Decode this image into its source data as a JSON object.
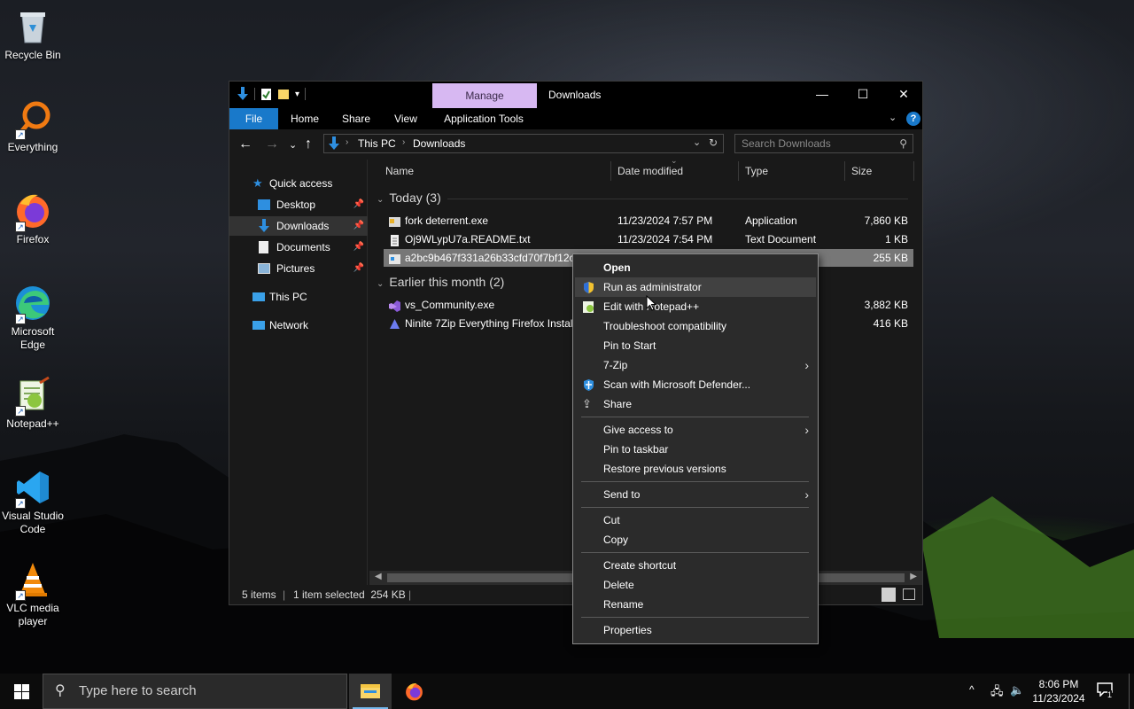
{
  "desktop": {
    "icons": [
      {
        "label": "Recycle Bin",
        "icon": "recycle-bin-icon"
      },
      {
        "label": "Everything",
        "icon": "everything-search-icon"
      },
      {
        "label": "Firefox",
        "icon": "firefox-icon"
      },
      {
        "label": "Microsoft Edge",
        "icon": "edge-icon"
      },
      {
        "label": "Notepad++",
        "icon": "notepadpp-icon"
      },
      {
        "label": "Visual Studio Code",
        "icon": "vscode-icon"
      },
      {
        "label": "VLC media player",
        "icon": "vlc-icon"
      }
    ]
  },
  "window": {
    "manage_tab": "Manage",
    "title": "Downloads",
    "ribbon_tabs": [
      "File",
      "Home",
      "Share",
      "View",
      "Application Tools"
    ],
    "breadcrumb": [
      "This PC",
      "Downloads"
    ],
    "search_placeholder": "Search Downloads",
    "nav": {
      "quick_access": "Quick access",
      "items": [
        "Desktop",
        "Downloads",
        "Documents",
        "Pictures"
      ],
      "this_pc": "This PC",
      "network": "Network"
    },
    "columns": [
      "Name",
      "Date modified",
      "Type",
      "Size"
    ],
    "groups": [
      {
        "label": "Today (3)",
        "files": [
          {
            "name": "fork deterrent.exe",
            "date": "11/23/2024 7:57 PM",
            "type": "Application",
            "size": "7,860 KB"
          },
          {
            "name": "Oj9WLypU7a.README.txt",
            "date": "11/23/2024 7:54 PM",
            "type": "Text Document",
            "size": "1 KB"
          },
          {
            "name": "a2bc9b467f331a26b33cfd70f7bf12c9",
            "date": "",
            "type": "",
            "size": "255 KB"
          }
        ]
      },
      {
        "label": "Earlier this month (2)",
        "files": [
          {
            "name": "vs_Community.exe",
            "date": "",
            "type": "",
            "size": "3,882 KB"
          },
          {
            "name": "Ninite 7Zip Everything Firefox Install",
            "date": "",
            "type": "",
            "size": "416 KB"
          }
        ]
      }
    ],
    "status": {
      "items": "5 items",
      "selected": "1 item selected  254 KB"
    }
  },
  "context_menu": {
    "items": [
      "Open",
      "Run as administrator",
      "Edit with Notepad++",
      "Troubleshoot compatibility",
      "Pin to Start",
      "7-Zip",
      "Scan with Microsoft Defender...",
      "Share",
      "Give access to",
      "Pin to taskbar",
      "Restore previous versions",
      "Send to",
      "Cut",
      "Copy",
      "Create shortcut",
      "Delete",
      "Rename",
      "Properties"
    ],
    "highlighted": "Run as administrator"
  },
  "taskbar": {
    "search_placeholder": "Type here to search",
    "time": "8:06 PM",
    "date": "11/23/2024",
    "notification_count": "1"
  },
  "colors": {
    "accent": "#1979ca",
    "manage_tab": "#d7b8f2",
    "selection": "#777777",
    "menu_bg": "#2b2b2b"
  }
}
